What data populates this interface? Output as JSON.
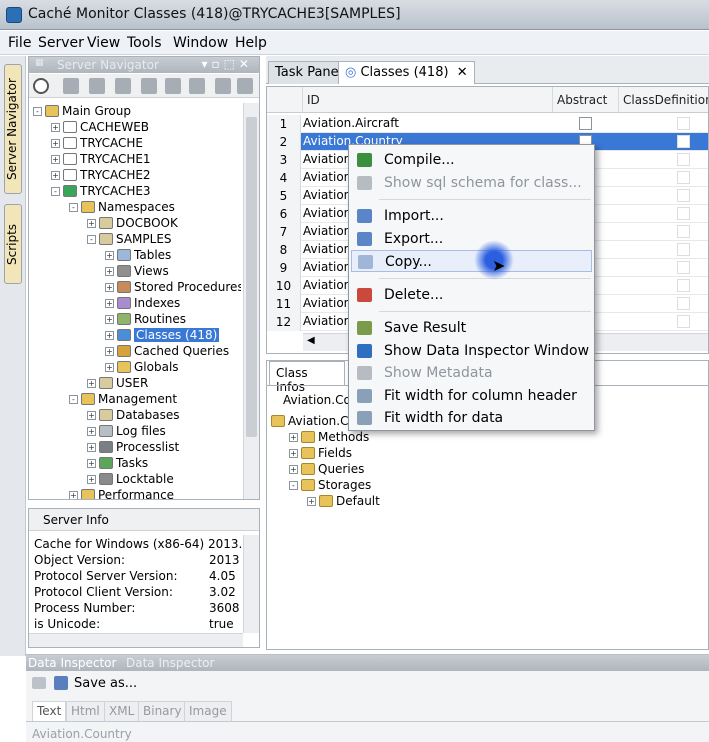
{
  "window": {
    "title": "Caché Monitor  Classes (418)@TRYCACHE3[SAMPLES]"
  },
  "menubar": [
    "File",
    "Server",
    "View",
    "Tools",
    "Window",
    "Help"
  ],
  "side_tabs": [
    "Server Navigator",
    "Scripts"
  ],
  "navigator": {
    "title": "Server Navigator",
    "tree": [
      {
        "label": "Main Group",
        "indent": 0,
        "exp": "-",
        "icon": "folder-icon"
      },
      {
        "label": "CACHEWEB",
        "indent": 1,
        "exp": "+",
        "icon": "connection-icon"
      },
      {
        "label": "TRYCACHE",
        "indent": 1,
        "exp": "+",
        "icon": "connection-icon"
      },
      {
        "label": "TRYCACHE1",
        "indent": 1,
        "exp": "+",
        "icon": "connection-icon"
      },
      {
        "label": "TRYCACHE2",
        "indent": 1,
        "exp": "+",
        "icon": "connection-icon"
      },
      {
        "label": "TRYCACHE3",
        "indent": 1,
        "exp": "-",
        "icon": "connected-icon"
      },
      {
        "label": "Namespaces",
        "indent": 2,
        "exp": "-",
        "icon": "folder-icon"
      },
      {
        "label": "DOCBOOK",
        "indent": 3,
        "exp": "+",
        "icon": "database-icon"
      },
      {
        "label": "SAMPLES",
        "indent": 3,
        "exp": "-",
        "icon": "database-icon"
      },
      {
        "label": "Tables",
        "indent": 4,
        "exp": "+",
        "icon": "table-icon"
      },
      {
        "label": "Views",
        "indent": 4,
        "exp": "+",
        "icon": "view-icon"
      },
      {
        "label": "Stored Procedures",
        "indent": 4,
        "exp": "+",
        "icon": "procedure-icon"
      },
      {
        "label": "Indexes",
        "indent": 4,
        "exp": "+",
        "icon": "index-icon"
      },
      {
        "label": "Routines",
        "indent": 4,
        "exp": "+",
        "icon": "routine-icon"
      },
      {
        "label": "Classes (418)",
        "indent": 4,
        "exp": "+",
        "icon": "class-icon",
        "selected": true
      },
      {
        "label": "Cached Queries",
        "indent": 4,
        "exp": "+",
        "icon": "query-icon"
      },
      {
        "label": "Globals",
        "indent": 4,
        "exp": "+",
        "icon": "folder-icon"
      },
      {
        "label": "USER",
        "indent": 3,
        "exp": "+",
        "icon": "database-icon"
      },
      {
        "label": "Management",
        "indent": 2,
        "exp": "-",
        "icon": "folder-icon"
      },
      {
        "label": "Databases",
        "indent": 3,
        "exp": "+",
        "icon": "database-icon"
      },
      {
        "label": "Log files",
        "indent": 3,
        "exp": "+",
        "icon": "log-icon"
      },
      {
        "label": "Processlist",
        "indent": 3,
        "exp": "+",
        "icon": "process-icon"
      },
      {
        "label": "Tasks",
        "indent": 3,
        "exp": "+",
        "icon": "task-icon"
      },
      {
        "label": "Locktable",
        "indent": 3,
        "exp": "+",
        "icon": "lock-icon"
      },
      {
        "label": "Performance",
        "indent": 2,
        "exp": "+",
        "icon": "folder-icon"
      }
    ]
  },
  "server_info": {
    "title": "Server Info",
    "rows": [
      {
        "k": "Cache for Windows (x86-64) 2013.",
        "v": ""
      },
      {
        "k": "Object Version:",
        "v": "2013"
      },
      {
        "k": "Protocol Server Version:",
        "v": "4.05"
      },
      {
        "k": "Protocol Client Version:",
        "v": "3.02"
      },
      {
        "k": "Process Number:",
        "v": "3608"
      },
      {
        "k": "is Unicode:",
        "v": "true"
      }
    ]
  },
  "tabs": [
    {
      "label": "Task Pane"
    },
    {
      "label": "Classes (418)",
      "close": "✕"
    }
  ],
  "grid": {
    "headers": [
      "ID",
      "Abstract",
      "ClassDefinition"
    ],
    "rows": [
      {
        "n": "1",
        "id": "Aviation.Aircraft"
      },
      {
        "n": "2",
        "id": "Aviation.Country"
      },
      {
        "n": "3",
        "id": "Aviation"
      },
      {
        "n": "4",
        "id": "Aviation"
      },
      {
        "n": "5",
        "id": "Aviation"
      },
      {
        "n": "6",
        "id": "Aviation"
      },
      {
        "n": "7",
        "id": "Aviation"
      },
      {
        "n": "8",
        "id": "Aviation"
      },
      {
        "n": "9",
        "id": "Aviation"
      },
      {
        "n": "10",
        "id": "Aviation"
      },
      {
        "n": "11",
        "id": "Aviation"
      },
      {
        "n": "12",
        "id": "Aviation"
      }
    ]
  },
  "class_infos": {
    "tab": "Class Infos",
    "breadcrumb": "Aviation.Co",
    "tree": [
      {
        "label": "Aviation.C",
        "indent": 0,
        "exp": ""
      },
      {
        "label": "Methods",
        "indent": 1,
        "exp": "+"
      },
      {
        "label": "Fields",
        "indent": 1,
        "exp": "+"
      },
      {
        "label": "Queries",
        "indent": 1,
        "exp": "+"
      },
      {
        "label": "Storages",
        "indent": 1,
        "exp": "-"
      },
      {
        "label": "Default",
        "indent": 2,
        "exp": "+"
      }
    ]
  },
  "context_menu": {
    "items": [
      {
        "label": "Compile...",
        "icon": "compile-icon",
        "state": "normal"
      },
      {
        "label": "Show sql schema for class...",
        "icon": "schema-icon",
        "state": "disabled"
      },
      {
        "sep": true
      },
      {
        "label": "Import...",
        "icon": "import-icon",
        "state": "normal"
      },
      {
        "label": "Export...",
        "icon": "export-icon",
        "state": "normal"
      },
      {
        "label": "Copy...",
        "icon": "copy-icon",
        "state": "highlighted"
      },
      {
        "sep": true
      },
      {
        "label": "Delete...",
        "icon": "delete-icon",
        "state": "normal"
      },
      {
        "sep": true
      },
      {
        "label": "Save Result",
        "icon": "save-icon",
        "state": "normal"
      },
      {
        "label": "Show Data Inspector Window",
        "icon": "info-icon",
        "state": "normal"
      },
      {
        "label": "Show Metadata",
        "icon": "metadata-icon",
        "state": "disabled"
      },
      {
        "label": "Fit width for column header",
        "icon": "fit-icon",
        "state": "normal"
      },
      {
        "label": "Fit width for data",
        "icon": "fit-icon",
        "state": "normal"
      }
    ]
  },
  "data_inspector": {
    "titles": [
      "Data Inspector",
      "Data Inspector"
    ],
    "save_label": "Save as...",
    "tabs": [
      "Text",
      "Html",
      "XML",
      "Binary",
      "Image"
    ],
    "value": "Aviation.Country"
  },
  "colors": {
    "selection": "#3a78d6",
    "accent": "#2d6fb5"
  }
}
